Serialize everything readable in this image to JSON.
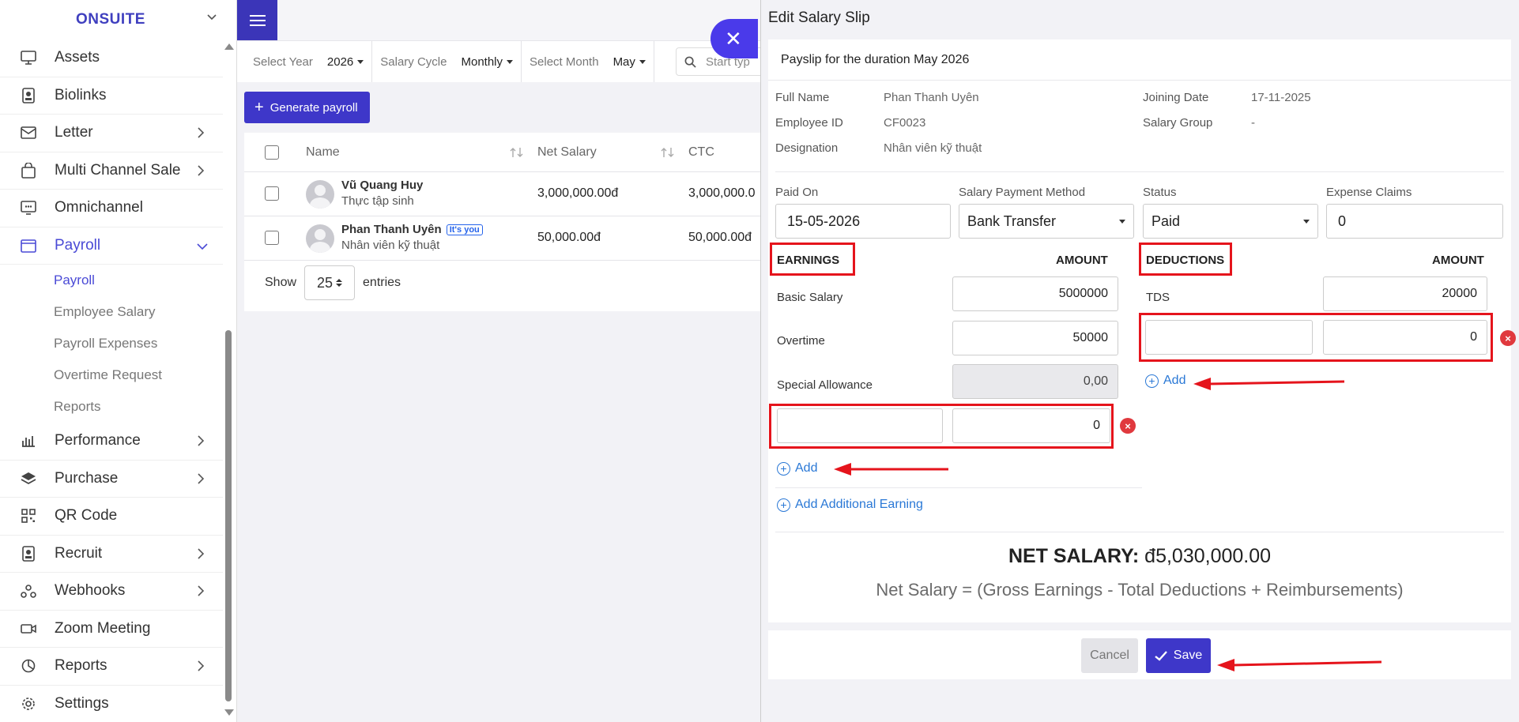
{
  "colors": {
    "accent": "#3e37c9",
    "annotation_red": "#e5141c",
    "link_blue": "#2a78d6"
  },
  "sidebar": {
    "brand": "ONSUITE",
    "items": [
      {
        "label": "Assets",
        "icon": "monitor-icon",
        "arrow": false
      },
      {
        "label": "Biolinks",
        "icon": "badge-icon",
        "arrow": false
      },
      {
        "label": "Letter",
        "icon": "mail-icon",
        "arrow": true
      },
      {
        "label": "Multi Channel Sale",
        "icon": "shopping-bag-icon",
        "arrow": true
      },
      {
        "label": "Omnichannel",
        "icon": "chat-screen-icon",
        "arrow": false
      },
      {
        "label": "Payroll",
        "icon": "wallet-icon",
        "arrow": true,
        "active": true
      }
    ],
    "payroll_sub": [
      "Payroll",
      "Employee Salary",
      "Payroll Expenses",
      "Overtime Request",
      "Reports"
    ],
    "items_after": [
      {
        "label": "Performance",
        "icon": "bar-chart-icon",
        "arrow": true
      },
      {
        "label": "Purchase",
        "icon": "layers-icon",
        "arrow": true
      },
      {
        "label": "QR Code",
        "icon": "qr-code-icon",
        "arrow": false
      },
      {
        "label": "Recruit",
        "icon": "badge-icon",
        "arrow": true
      },
      {
        "label": "Webhooks",
        "icon": "webhook-icon",
        "arrow": true
      },
      {
        "label": "Zoom Meeting",
        "icon": "video-icon",
        "arrow": false
      },
      {
        "label": "Reports",
        "icon": "pie-chart-icon",
        "arrow": true
      },
      {
        "label": "Settings",
        "icon": "gear-icon",
        "arrow": false
      }
    ]
  },
  "filters": {
    "year_label": "Select Year",
    "year_value": "2026",
    "cycle_label": "Salary Cycle",
    "cycle_value": "Monthly",
    "month_label": "Select Month",
    "month_value": "May",
    "search_placeholder": "Start typ"
  },
  "generate_button": "Generate payroll",
  "table": {
    "headers": {
      "name": "Name",
      "net": "Net Salary",
      "ctc": "CTC"
    },
    "rows": [
      {
        "name": "Vũ Quang Huy",
        "role": "Thực tập sinh",
        "net": "3,000,000.00đ",
        "ctc": "3,000,000.0"
      },
      {
        "name": "Phan Thanh Uyên",
        "badge": "It's you",
        "role": "Nhân viên kỹ thuật",
        "net": "50,000.00đ",
        "ctc": "50,000.00đ"
      }
    ],
    "show_label": "Show",
    "show_value": "25",
    "entries_label": "entries"
  },
  "modal": {
    "title": "Edit Salary Slip",
    "payslip_heading": "Payslip for the duration May 2026",
    "info": {
      "full_name_k": "Full Name",
      "full_name_v": "Phan Thanh Uyên",
      "employee_id_k": "Employee ID",
      "employee_id_v": "CF0023",
      "designation_k": "Designation",
      "designation_v": "Nhân viên kỹ thuật",
      "joining_date_k": "Joining Date",
      "joining_date_v": "17-11-2025",
      "salary_group_k": "Salary Group",
      "salary_group_v": "-"
    },
    "paid_on_label": "Paid On",
    "paid_on_value": "15-05-2026",
    "method_label": "Salary Payment Method",
    "method_value": "Bank Transfer",
    "status_label": "Status",
    "status_value": "Paid",
    "claims_label": "Expense Claims",
    "claims_value": "0",
    "earnings": {
      "title": "EARNINGS",
      "amount_label": "AMOUNT",
      "rows": [
        {
          "label": "Basic Salary",
          "value": "5000000"
        },
        {
          "label": "Overtime",
          "value": "50000"
        },
        {
          "label": "Special Allowance",
          "value": "0,00"
        }
      ],
      "new_row_value": "0",
      "add": "Add",
      "add_additional": "Add Additional Earning"
    },
    "deductions": {
      "title": "DEDUCTIONS",
      "amount_label": "AMOUNT",
      "rows": [
        {
          "label": "TDS",
          "value": "20000"
        }
      ],
      "new_row_value": "0",
      "add": "Add"
    },
    "net_label": "NET SALARY:",
    "net_value": "đ5,030,000.00",
    "net_formula": "Net Salary = (Gross Earnings - Total Deductions + Reimbursements)",
    "cancel": "Cancel",
    "save": "Save"
  }
}
